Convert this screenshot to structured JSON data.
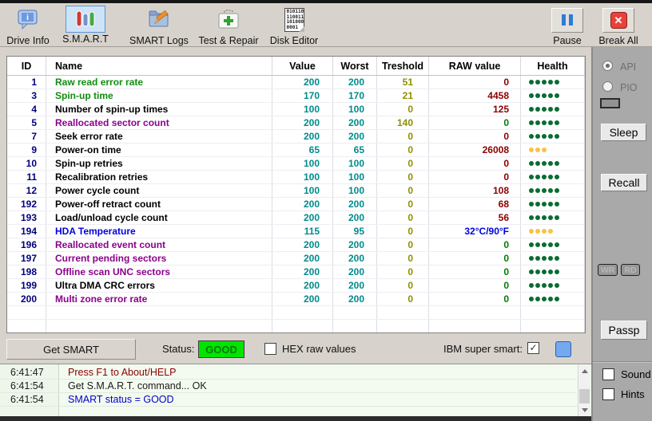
{
  "toolbar": {
    "buttons": [
      {
        "label": "Drive Info"
      },
      {
        "label": "S.M.A.R.T"
      },
      {
        "label": "SMART Logs"
      },
      {
        "label": "Test & Repair"
      },
      {
        "label": "Disk Editor"
      },
      {
        "label": "Pause"
      },
      {
        "label": "Break All"
      }
    ],
    "disk_editor_binary": [
      "010110",
      "110011",
      "101000",
      "0001"
    ]
  },
  "table": {
    "columns": [
      "ID",
      "Name",
      "Value",
      "Worst",
      "Treshold",
      "RAW value",
      "Health"
    ],
    "colors": {
      "id": "#00007d",
      "value": "#008b8b",
      "treshold": "#8f8f00",
      "dot_green": "#0a6c34",
      "dot_yellow": "#f6c445"
    },
    "rows": [
      {
        "id": "1",
        "name": "Raw read error rate",
        "name_color": "#118c11",
        "value": "200",
        "worst": "200",
        "treshold": "51",
        "raw": "0",
        "raw_color": "#8b0000",
        "health": {
          "count": 5,
          "color": "#0a6c34"
        }
      },
      {
        "id": "3",
        "name": "Spin-up time",
        "name_color": "#118c11",
        "value": "170",
        "worst": "170",
        "treshold": "21",
        "raw": "4458",
        "raw_color": "#8b0000",
        "health": {
          "count": 5,
          "color": "#0a6c34"
        }
      },
      {
        "id": "4",
        "name": "Number of spin-up times",
        "name_color": "#000000",
        "value": "100",
        "worst": "100",
        "treshold": "0",
        "raw": "125",
        "raw_color": "#8b0000",
        "health": {
          "count": 5,
          "color": "#0a6c34"
        }
      },
      {
        "id": "5",
        "name": "Reallocated sector count",
        "name_color": "#8b008b",
        "value": "200",
        "worst": "200",
        "treshold": "140",
        "raw": "0",
        "raw_color": "#007c00",
        "health": {
          "count": 5,
          "color": "#0a6c34"
        }
      },
      {
        "id": "7",
        "name": "Seek error rate",
        "name_color": "#000000",
        "value": "200",
        "worst": "200",
        "treshold": "0",
        "raw": "0",
        "raw_color": "#8b0000",
        "health": {
          "count": 5,
          "color": "#0a6c34"
        }
      },
      {
        "id": "9",
        "name": "Power-on time",
        "name_color": "#000000",
        "value": "65",
        "worst": "65",
        "treshold": "0",
        "raw": "26008",
        "raw_color": "#8b0000",
        "health": {
          "count": 3,
          "color": "#f6c445"
        }
      },
      {
        "id": "10",
        "name": "Spin-up retries",
        "name_color": "#000000",
        "value": "100",
        "worst": "100",
        "treshold": "0",
        "raw": "0",
        "raw_color": "#8b0000",
        "health": {
          "count": 5,
          "color": "#0a6c34"
        }
      },
      {
        "id": "11",
        "name": "Recalibration retries",
        "name_color": "#000000",
        "value": "100",
        "worst": "100",
        "treshold": "0",
        "raw": "0",
        "raw_color": "#8b0000",
        "health": {
          "count": 5,
          "color": "#0a6c34"
        }
      },
      {
        "id": "12",
        "name": "Power cycle count",
        "name_color": "#000000",
        "value": "100",
        "worst": "100",
        "treshold": "0",
        "raw": "108",
        "raw_color": "#8b0000",
        "health": {
          "count": 5,
          "color": "#0a6c34"
        }
      },
      {
        "id": "192",
        "name": "Power-off retract count",
        "name_color": "#000000",
        "value": "200",
        "worst": "200",
        "treshold": "0",
        "raw": "68",
        "raw_color": "#8b0000",
        "health": {
          "count": 5,
          "color": "#0a6c34"
        }
      },
      {
        "id": "193",
        "name": "Load/unload cycle count",
        "name_color": "#000000",
        "value": "200",
        "worst": "200",
        "treshold": "0",
        "raw": "56",
        "raw_color": "#8b0000",
        "health": {
          "count": 5,
          "color": "#0a6c34"
        }
      },
      {
        "id": "194",
        "name": "HDA Temperature",
        "name_color": "#0000e0",
        "value": "115",
        "worst": "95",
        "treshold": "0",
        "raw": "32°C/90°F",
        "raw_color": "#0000e0",
        "health": {
          "count": 4,
          "color": "#f6c445"
        }
      },
      {
        "id": "196",
        "name": "Reallocated event count",
        "name_color": "#8b008b",
        "value": "200",
        "worst": "200",
        "treshold": "0",
        "raw": "0",
        "raw_color": "#007c00",
        "health": {
          "count": 5,
          "color": "#0a6c34"
        }
      },
      {
        "id": "197",
        "name": "Current pending sectors",
        "name_color": "#8b008b",
        "value": "200",
        "worst": "200",
        "treshold": "0",
        "raw": "0",
        "raw_color": "#007c00",
        "health": {
          "count": 5,
          "color": "#0a6c34"
        }
      },
      {
        "id": "198",
        "name": "Offline scan UNC sectors",
        "name_color": "#8b008b",
        "value": "200",
        "worst": "200",
        "treshold": "0",
        "raw": "0",
        "raw_color": "#007c00",
        "health": {
          "count": 5,
          "color": "#0a6c34"
        }
      },
      {
        "id": "199",
        "name": "Ultra DMA CRC errors",
        "name_color": "#000000",
        "value": "200",
        "worst": "200",
        "treshold": "0",
        "raw": "0",
        "raw_color": "#007c00",
        "health": {
          "count": 5,
          "color": "#0a6c34"
        }
      },
      {
        "id": "200",
        "name": "Multi zone error rate",
        "name_color": "#8b008b",
        "value": "200",
        "worst": "200",
        "treshold": "0",
        "raw": "0",
        "raw_color": "#007c00",
        "health": {
          "count": 5,
          "color": "#0a6c34"
        }
      }
    ]
  },
  "status_bar": {
    "get_smart_label": "Get SMART",
    "status_label": "Status:",
    "status_value": "GOOD",
    "status_bg_color": "#00e400",
    "hex_checkbox_label": "HEX raw values",
    "hex_checked": false,
    "ibm_label": "IBM super smart:",
    "ibm_checked": true
  },
  "log": {
    "entries": [
      {
        "time": "6:41:47",
        "text": "Press F1 to About/HELP",
        "color": "#8b0000"
      },
      {
        "time": "6:41:54",
        "text": "Get S.M.A.R.T. command... OK",
        "color": "#1a1a1a"
      },
      {
        "time": "6:41:54",
        "text": "SMART status = GOOD",
        "color": "#0000cd"
      }
    ]
  },
  "right_panel": {
    "api_label": "API",
    "api_selected": true,
    "pio_label": "PIO",
    "pio_selected": false,
    "sleep_label": "Sleep",
    "recall_label": "Recall",
    "wr_label": "WR",
    "rd_label": "RD",
    "passp_label": "Passp",
    "sound_label": "Sound",
    "sound_checked": false,
    "hints_label": "Hints",
    "hints_checked": false
  }
}
